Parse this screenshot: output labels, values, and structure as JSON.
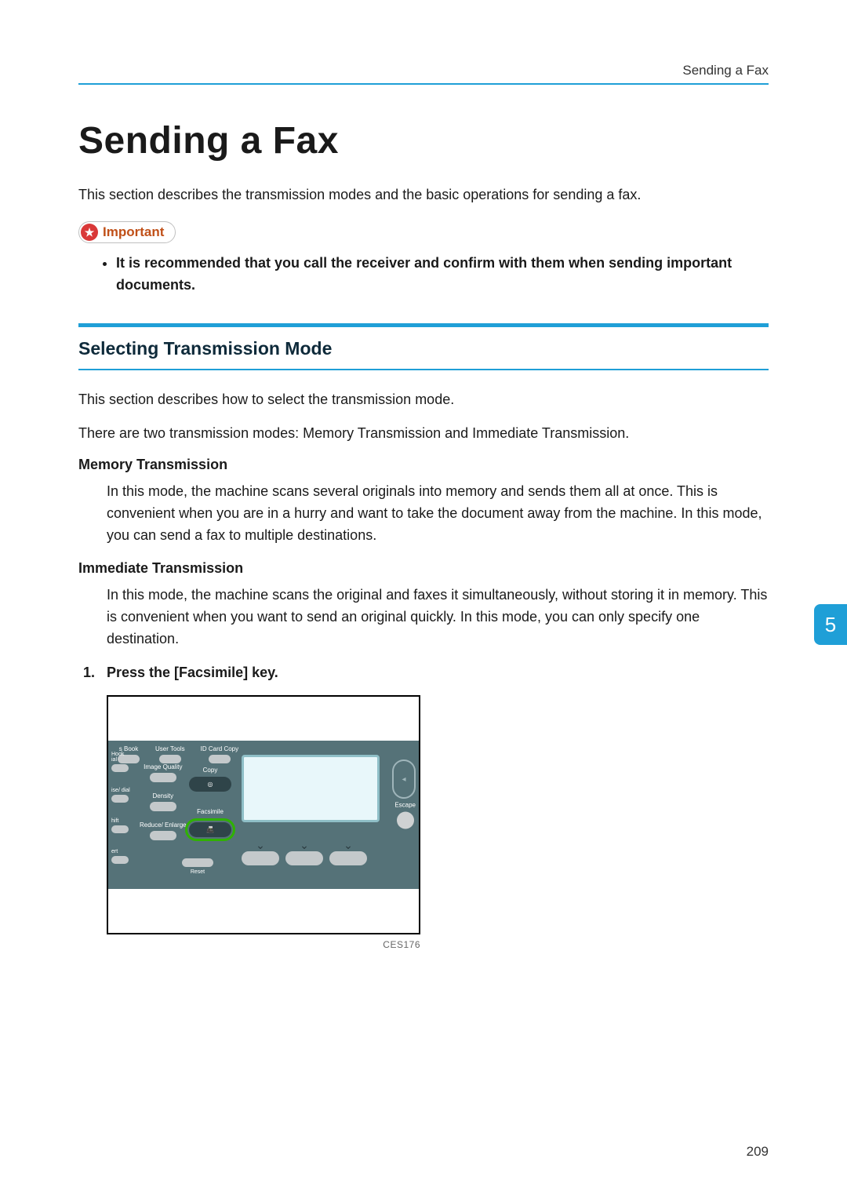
{
  "running_header": "Sending a Fax",
  "title": "Sending a Fax",
  "intro": "This section describes the transmission modes and the basic operations for sending a fax.",
  "important_label": "Important",
  "important_bullet": "It is recommended that you call the receiver and confirm with them when sending important documents.",
  "section": {
    "title": "Selecting Transmission Mode",
    "p1": "This section describes how to select the transmission mode.",
    "p2": "There are two transmission modes: Memory Transmission and Immediate Transmission."
  },
  "memory": {
    "heading": "Memory Transmission",
    "text": "In this mode, the machine scans several originals into memory and sends them all at once. This is convenient when you are in a hurry and want to take the document away from the machine. In this mode, you can send a fax to multiple destinations."
  },
  "immediate": {
    "heading": "Immediate Transmission",
    "text": "In this mode, the machine scans the original and faxes it simultaneously, without storing it in memory. This is convenient when you want to send an original quickly. In this mode, you can only specify one destination."
  },
  "step1": "Press the [Facsimile] key.",
  "figure_code": "CES176",
  "panel": {
    "top_labels": [
      "s Book",
      "User Tools",
      "ID Card Copy"
    ],
    "left_labels": [
      "Hook\nial",
      "ise/\ndial",
      "hift",
      "ert"
    ],
    "mid_labels": [
      "Image\nQuality",
      "Density",
      "Reduce/\nEnlarge"
    ],
    "mode_copy": "Copy",
    "mode_fax": "Facsimile",
    "mode_reset": "Reset",
    "escape": "Escape",
    "dpad": "◂"
  },
  "side_tab": "5",
  "page_number": "209"
}
